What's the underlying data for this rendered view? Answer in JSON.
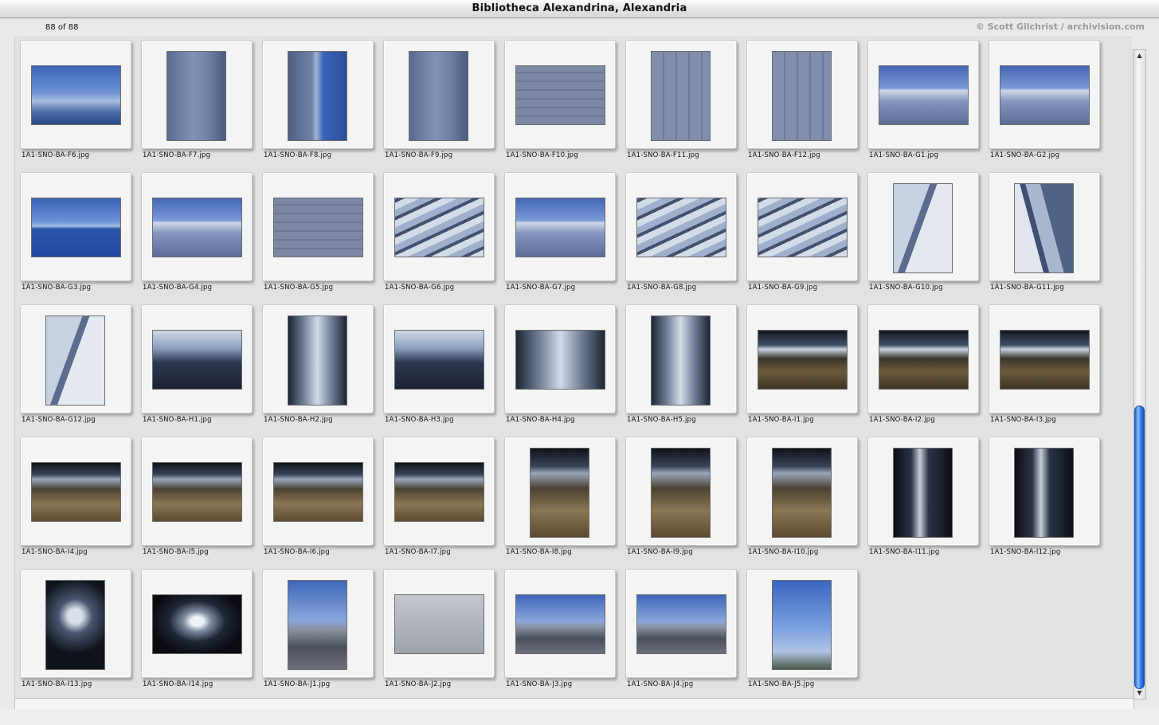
{
  "window": {
    "title": "Bibliotheca Alexandrina, Alexandria",
    "count": "88 of 88",
    "credit": "© Scott Gilchrist / archivision.com"
  },
  "thumbnails": [
    {
      "name": "1A1-SNO-BA-F6.jpg",
      "orient": "land",
      "style": "p-sky"
    },
    {
      "name": "1A1-SNO-BA-F7.jpg",
      "orient": "port",
      "style": "p-wall"
    },
    {
      "name": "1A1-SNO-BA-F8.jpg",
      "orient": "port",
      "style": "p-wall2"
    },
    {
      "name": "1A1-SNO-BA-F9.jpg",
      "orient": "port",
      "style": "p-wall"
    },
    {
      "name": "1A1-SNO-BA-F10.jpg",
      "orient": "land",
      "style": "p-stone"
    },
    {
      "name": "1A1-SNO-BA-F11.jpg",
      "orient": "port",
      "style": "p-stone2"
    },
    {
      "name": "1A1-SNO-BA-F12.jpg",
      "orient": "port",
      "style": "p-stone2"
    },
    {
      "name": "1A1-SNO-BA-G1.jpg",
      "orient": "land",
      "style": "p-roof"
    },
    {
      "name": "1A1-SNO-BA-G2.jpg",
      "orient": "land",
      "style": "p-roof"
    },
    {
      "name": "1A1-SNO-BA-G3.jpg",
      "orient": "land",
      "style": "p-pool"
    },
    {
      "name": "1A1-SNO-BA-G4.jpg",
      "orient": "land",
      "style": "p-roof"
    },
    {
      "name": "1A1-SNO-BA-G5.jpg",
      "orient": "land",
      "style": "p-stone"
    },
    {
      "name": "1A1-SNO-BA-G6.jpg",
      "orient": "land",
      "style": "p-panels"
    },
    {
      "name": "1A1-SNO-BA-G7.jpg",
      "orient": "land",
      "style": "p-roof"
    },
    {
      "name": "1A1-SNO-BA-G8.jpg",
      "orient": "land",
      "style": "p-panels"
    },
    {
      "name": "1A1-SNO-BA-G9.jpg",
      "orient": "land",
      "style": "p-panels"
    },
    {
      "name": "1A1-SNO-BA-G10.jpg",
      "orient": "port",
      "style": "p-fin"
    },
    {
      "name": "1A1-SNO-BA-G11.jpg",
      "orient": "port",
      "style": "p-fin2"
    },
    {
      "name": "1A1-SNO-BA-G12.jpg",
      "orient": "port",
      "style": "p-fin"
    },
    {
      "name": "1A1-SNO-BA-H1.jpg",
      "orient": "land",
      "style": "p-interior"
    },
    {
      "name": "1A1-SNO-BA-H2.jpg",
      "orient": "port",
      "style": "p-interior2"
    },
    {
      "name": "1A1-SNO-BA-H3.jpg",
      "orient": "land",
      "style": "p-interior"
    },
    {
      "name": "1A1-SNO-BA-H4.jpg",
      "orient": "land",
      "style": "p-interior2"
    },
    {
      "name": "1A1-SNO-BA-H5.jpg",
      "orient": "port",
      "style": "p-interior2"
    },
    {
      "name": "1A1-SNO-BA-I1.jpg",
      "orient": "land",
      "style": "p-hall"
    },
    {
      "name": "1A1-SNO-BA-I2.jpg",
      "orient": "land",
      "style": "p-hall"
    },
    {
      "name": "1A1-SNO-BA-I3.jpg",
      "orient": "land",
      "style": "p-hall"
    },
    {
      "name": "1A1-SNO-BA-I4.jpg",
      "orient": "land",
      "style": "p-hall2"
    },
    {
      "name": "1A1-SNO-BA-I5.jpg",
      "orient": "land",
      "style": "p-hall2"
    },
    {
      "name": "1A1-SNO-BA-I6.jpg",
      "orient": "land",
      "style": "p-hall2"
    },
    {
      "name": "1A1-SNO-BA-I7.jpg",
      "orient": "land",
      "style": "p-hall2"
    },
    {
      "name": "1A1-SNO-BA-I8.jpg",
      "orient": "port",
      "style": "p-hall2"
    },
    {
      "name": "1A1-SNO-BA-I9.jpg",
      "orient": "port",
      "style": "p-hall2"
    },
    {
      "name": "1A1-SNO-BA-I10.jpg",
      "orient": "port",
      "style": "p-hall2"
    },
    {
      "name": "1A1-SNO-BA-I11.jpg",
      "orient": "port",
      "style": "p-dark"
    },
    {
      "name": "1A1-SNO-BA-I12.jpg",
      "orient": "port",
      "style": "p-dark"
    },
    {
      "name": "1A1-SNO-BA-I13.jpg",
      "orient": "port",
      "style": "p-dome"
    },
    {
      "name": "1A1-SNO-BA-I14.jpg",
      "orient": "land",
      "style": "p-tunnel"
    },
    {
      "name": "1A1-SNO-BA-J1.jpg",
      "orient": "port",
      "style": "p-street"
    },
    {
      "name": "1A1-SNO-BA-J2.jpg",
      "orient": "land",
      "style": "p-slab"
    },
    {
      "name": "1A1-SNO-BA-J3.jpg",
      "orient": "land",
      "style": "p-street"
    },
    {
      "name": "1A1-SNO-BA-J4.jpg",
      "orient": "land",
      "style": "p-street"
    },
    {
      "name": "1A1-SNO-BA-J5.jpg",
      "orient": "port",
      "style": "p-tower"
    }
  ],
  "scrollbar": {
    "up_icon": "triangle-up-icon",
    "down_icon": "triangle-down-icon"
  }
}
